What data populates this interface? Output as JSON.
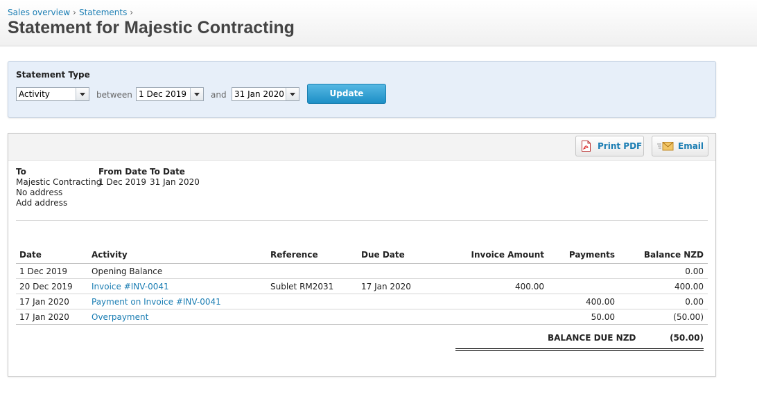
{
  "breadcrumb": {
    "items": [
      "Sales overview",
      "Statements"
    ],
    "separator": "›"
  },
  "page": {
    "title": "Statement for Majestic Contracting"
  },
  "statement_type": {
    "label": "Statement Type",
    "type_value": "Activity",
    "between_label": "between",
    "from_date": "1 Dec 2019",
    "and_label": "and",
    "to_date": "31 Jan 2020",
    "update_label": "Update"
  },
  "toolbar": {
    "print_pdf": "Print PDF",
    "email": "Email"
  },
  "address": {
    "to_label": "To",
    "to_name": "Majestic Contracting",
    "no_address": "No address",
    "add_address": "Add address",
    "from_label": "From Date",
    "from_value": "1 Dec 2019",
    "todate_label": "To Date",
    "todate_value": "31 Jan 2020"
  },
  "table": {
    "headers": [
      "Date",
      "Activity",
      "Reference",
      "Due Date",
      "Invoice Amount",
      "Payments",
      "Balance NZD"
    ],
    "rows": [
      {
        "date": "1 Dec 2019",
        "activity": "Opening Balance",
        "activity_link": false,
        "reference": "",
        "due": "",
        "invoice": "",
        "payments": "",
        "balance": "0.00"
      },
      {
        "date": "20 Dec 2019",
        "activity": "Invoice #INV-0041",
        "activity_link": true,
        "reference": "Sublet RM2031",
        "due": "17 Jan 2020",
        "invoice": "400.00",
        "payments": "",
        "balance": "400.00"
      },
      {
        "date": "17 Jan 2020",
        "activity": "Payment on Invoice #INV-0041",
        "activity_link": true,
        "reference": "",
        "due": "",
        "invoice": "",
        "payments": "400.00",
        "balance": "0.00"
      },
      {
        "date": "17 Jan 2020",
        "activity": "Overpayment",
        "activity_link": true,
        "reference": "",
        "due": "",
        "invoice": "",
        "payments": "50.00",
        "balance": "(50.00)"
      }
    ],
    "balance_due_label": "BALANCE DUE NZD",
    "balance_due_value": "(50.00)"
  },
  "colors": {
    "link": "#1a7db3",
    "update_button": "#2a9fd4",
    "panel_bg": "#e7eff9"
  },
  "icons": {
    "pdf": "pdf-icon",
    "email": "envelope-icon",
    "select": "chevron-down-icon"
  }
}
